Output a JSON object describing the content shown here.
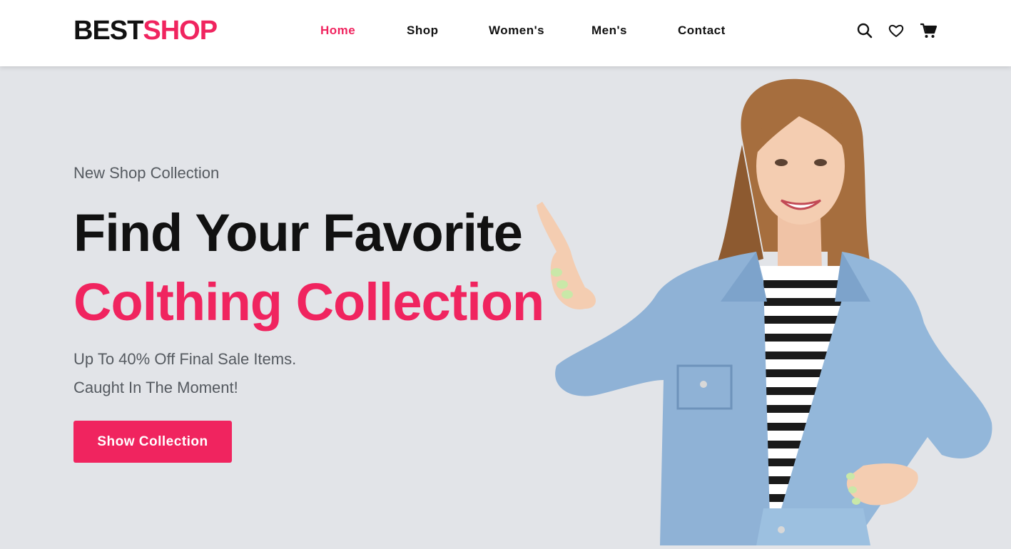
{
  "brand": {
    "part1": "BEST",
    "part2": "SHOP"
  },
  "nav": {
    "items": [
      {
        "label": "Home",
        "active": true
      },
      {
        "label": "Shop",
        "active": false
      },
      {
        "label": "Women's",
        "active": false
      },
      {
        "label": "Men's",
        "active": false
      },
      {
        "label": "Contact",
        "active": false
      }
    ]
  },
  "header_icons": [
    "search-icon",
    "heart-icon",
    "cart-icon"
  ],
  "hero": {
    "kicker": "New Shop Collection",
    "title_line1": "Find Your Favorite",
    "title_line2": "Colthing Collection",
    "subtitle_line1": "Up To 40% Off Final Sale Items.",
    "subtitle_line2": "Caught In The Moment!",
    "cta_label": "Show Collection"
  },
  "colors": {
    "accent": "#f0245f",
    "text_dark": "#111111",
    "text_muted": "#555a60",
    "hero_bg": "#e2e4e8",
    "header_bg": "#ffffff"
  }
}
